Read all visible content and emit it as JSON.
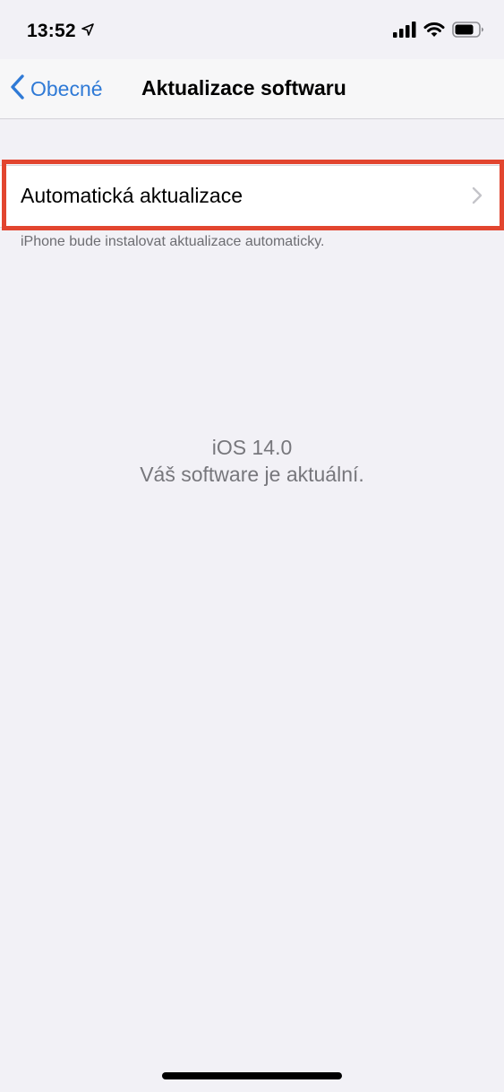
{
  "status_bar": {
    "time": "13:52",
    "location_icon": "location-arrow-icon",
    "signal_icon": "cellular-signal-icon",
    "wifi_icon": "wifi-icon",
    "battery_icon": "battery-icon"
  },
  "nav": {
    "back_label": "Obecné",
    "title": "Aktualizace softwaru"
  },
  "settings": {
    "auto_update_label": "Automatická aktualizace",
    "auto_update_footnote": "iPhone bude instalovat aktualizace automaticky."
  },
  "version": {
    "os": "iOS 14.0",
    "status": "Váš software je aktuální."
  },
  "colors": {
    "accent": "#2f7ad6",
    "highlight": "#e2452f",
    "background": "#f2f1f6"
  }
}
